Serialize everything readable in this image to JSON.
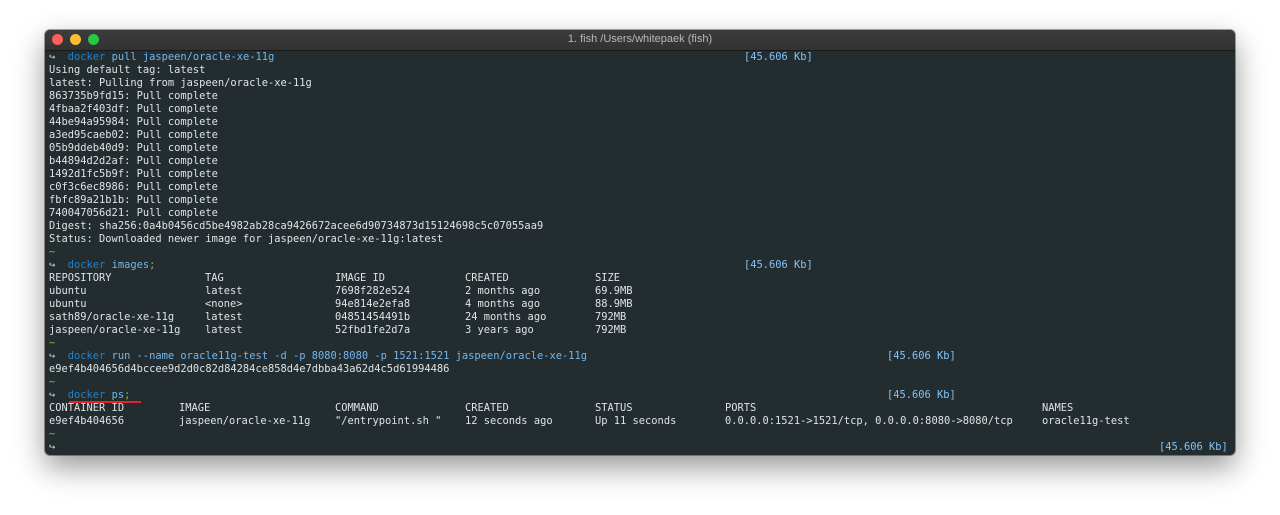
{
  "window": {
    "title": "1. fish /Users/whitepaek (fish)"
  },
  "prompt": {
    "arrow": "↪",
    "tilde": "~"
  },
  "pull": {
    "cmd": "docker",
    "args": "pull jaspeen/oracle-xe-11g",
    "size": "[45.606 Kb]",
    "output": [
      "Using default tag: latest",
      "latest: Pulling from jaspeen/oracle-xe-11g",
      "863735b9fd15: Pull complete",
      "4fbaa2f403df: Pull complete",
      "44be94a95984: Pull complete",
      "a3ed95caeb02: Pull complete",
      "05b9ddeb40d9: Pull complete",
      "b44894d2d2af: Pull complete",
      "1492d1fc5b9f: Pull complete",
      "c0f3c6ec8986: Pull complete",
      "fbfc89a21b1b: Pull complete",
      "740047056d21: Pull complete",
      "Digest: sha256:0a4b0456cd5be4982ab28ca9426672acee6d90734873d15124698c5c07055aa9",
      "Status: Downloaded newer image for jaspeen/oracle-xe-11g:latest"
    ]
  },
  "images": {
    "cmd": "docker",
    "args": "images",
    "semicolon": ";",
    "size": "[45.606 Kb]",
    "headers": [
      "REPOSITORY",
      "TAG",
      "IMAGE ID",
      "CREATED",
      "SIZE"
    ],
    "rows": [
      [
        "ubuntu",
        "latest",
        "7698f282e524",
        "2 months ago",
        "69.9MB"
      ],
      [
        "ubuntu",
        "<none>",
        "94e814e2efa8",
        "4 months ago",
        "88.9MB"
      ],
      [
        "sath89/oracle-xe-11g",
        "latest",
        "04851454491b",
        "24 months ago",
        "792MB"
      ],
      [
        "jaspeen/oracle-xe-11g",
        "latest",
        "52fbd1fe2d7a",
        "3 years ago",
        "792MB"
      ]
    ]
  },
  "run": {
    "cmd": "docker",
    "args": "run --name oracle11g-test -d -p 8080:8080 -p 1521:1521 jaspeen/oracle-xe-11g",
    "size": "[45.606 Kb]",
    "output": "e9ef4b404656d4bccee9d2d0c82d84284ce858d4e7dbba43a62d4c5d61994486"
  },
  "ps": {
    "cmd": "docker",
    "args": "ps",
    "semicolon": ";",
    "size": "[45.606 Kb]",
    "headers": [
      "CONTAINER ID",
      "IMAGE",
      "COMMAND",
      "CREATED",
      "STATUS",
      "PORTS",
      "NAMES"
    ],
    "rows": [
      [
        "e9ef4b404656",
        "jaspeen/oracle-xe-11g",
        "\"/entrypoint.sh \"",
        "12 seconds ago",
        "Up 11 seconds",
        "0.0.0.0:1521->1521/tcp, 0.0.0.0:8080->8080/tcp",
        "oracle11g-test"
      ]
    ]
  },
  "final": {
    "size": "[45.606 Kb]"
  },
  "colors": {
    "background": "#232c2f",
    "text": "#dfe3e6",
    "command": "#1f84cf",
    "argument": "#73b7ee",
    "tilde": "#8ab833",
    "size_indicator": "#83c3f5",
    "underline": "#e3242b"
  }
}
